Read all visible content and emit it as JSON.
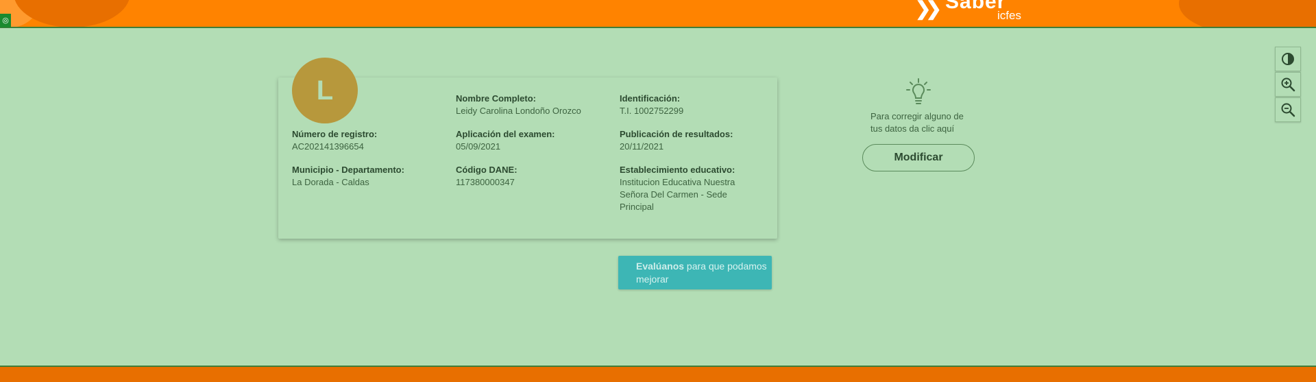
{
  "header": {
    "brand": "Sabér",
    "brand_sub": "icfes",
    "accessibility_badge": "◎"
  },
  "profile": {
    "initial": "L",
    "fields": {
      "nombre_label": "Nombre Completo:",
      "nombre_value": "Leidy Carolina Londoño Orozco",
      "id_label": "Identificación:",
      "id_value": "T.I. 1002752299",
      "registro_label": "Número de registro:",
      "registro_value": "AC202141396654",
      "aplicacion_label": "Aplicación del examen:",
      "aplicacion_value": "05/09/2021",
      "publicacion_label": "Publicación de resultados:",
      "publicacion_value": "20/11/2021",
      "municipio_label": "Municipio - Departamento:",
      "municipio_value": "La Dorada - Caldas",
      "dane_label": "Código DANE:",
      "dane_value": "117380000347",
      "establecimiento_label": "Establecimiento educativo:",
      "establecimiento_value": "Institucion Educativa Nuestra Señora Del Carmen - Sede Principal"
    }
  },
  "tip": {
    "text": "Para corregir alguno de tus datos da clic aquí",
    "button": "Modificar"
  },
  "feedback": {
    "bold": "Evalúanos",
    "rest": " para que podamos mejorar"
  },
  "tools": [
    "contrast-icon",
    "zoom-in-icon",
    "zoom-out-icon"
  ],
  "colors": {
    "header": "#ff8300",
    "background": "#b3ddb5",
    "avatar": "#b7983c",
    "feedback": "#3db6b5"
  }
}
